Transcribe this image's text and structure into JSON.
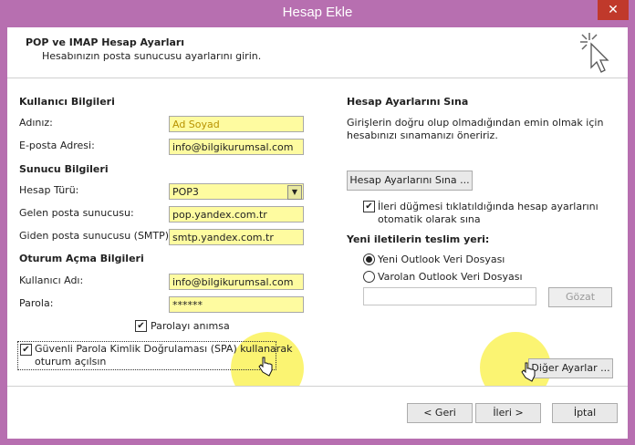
{
  "window": {
    "title": "Hesap Ekle",
    "close_glyph": "✕"
  },
  "header": {
    "title": "POP ve IMAP Hesap Ayarları",
    "subtitle": "Hesabınızın posta sunucusu ayarlarını girin.",
    "icon": "cursor-sparkle-icon"
  },
  "left": {
    "user_section": "Kullanıcı Bilgileri",
    "name_label": "Adınız:",
    "name_value": "Ad Soyad",
    "email_label": "E-posta Adresi:",
    "email_value": "info@bilgikurumsal.com",
    "server_section": "Sunucu Bilgileri",
    "account_type_label": "Hesap Türü:",
    "account_type_value": "POP3",
    "incoming_label": "Gelen posta sunucusu:",
    "incoming_value": "pop.yandex.com.tr",
    "outgoing_label": "Giden posta sunucusu (SMTP):",
    "outgoing_value": "smtp.yandex.com.tr",
    "login_section": "Oturum Açma Bilgileri",
    "username_label": "Kullanıcı Adı:",
    "username_value": "info@bilgikurumsal.com",
    "password_label": "Parola:",
    "password_value": "******",
    "remember_label": "Parolayı anımsa",
    "spa_label_line1": "Güvenli Parola Kimlik Doğrulaması (SPA) kullanarak",
    "spa_label_line2": "oturum açılsın"
  },
  "right": {
    "test_section": "Hesap Ayarlarını Sına",
    "test_desc_line1": "Girişlerin doğru olup olmadığından emin olmak için",
    "test_desc_line2": "hesabınızı sınamanızı öneririz.",
    "test_button": "Hesap Ayarlarını Sına ...",
    "auto_test_line1": "İleri düğmesi tıklatıldığında hesap ayarlarını",
    "auto_test_line2": "otomatik olarak sına",
    "deliver_section": "Yeni iletilerin teslim yeri:",
    "new_data_file": "Yeni Outlook Veri Dosyası",
    "existing_data_file": "Varolan Outlook Veri Dosyası",
    "browse_button": "Gözat",
    "more_settings_button": "Diğer Ayarlar ..."
  },
  "footer": {
    "back_button": "< Geri",
    "next_button": "İleri >",
    "cancel_button": "İptal"
  },
  "checkbox_glyph": "✔",
  "dropdown_glyph": "▼"
}
